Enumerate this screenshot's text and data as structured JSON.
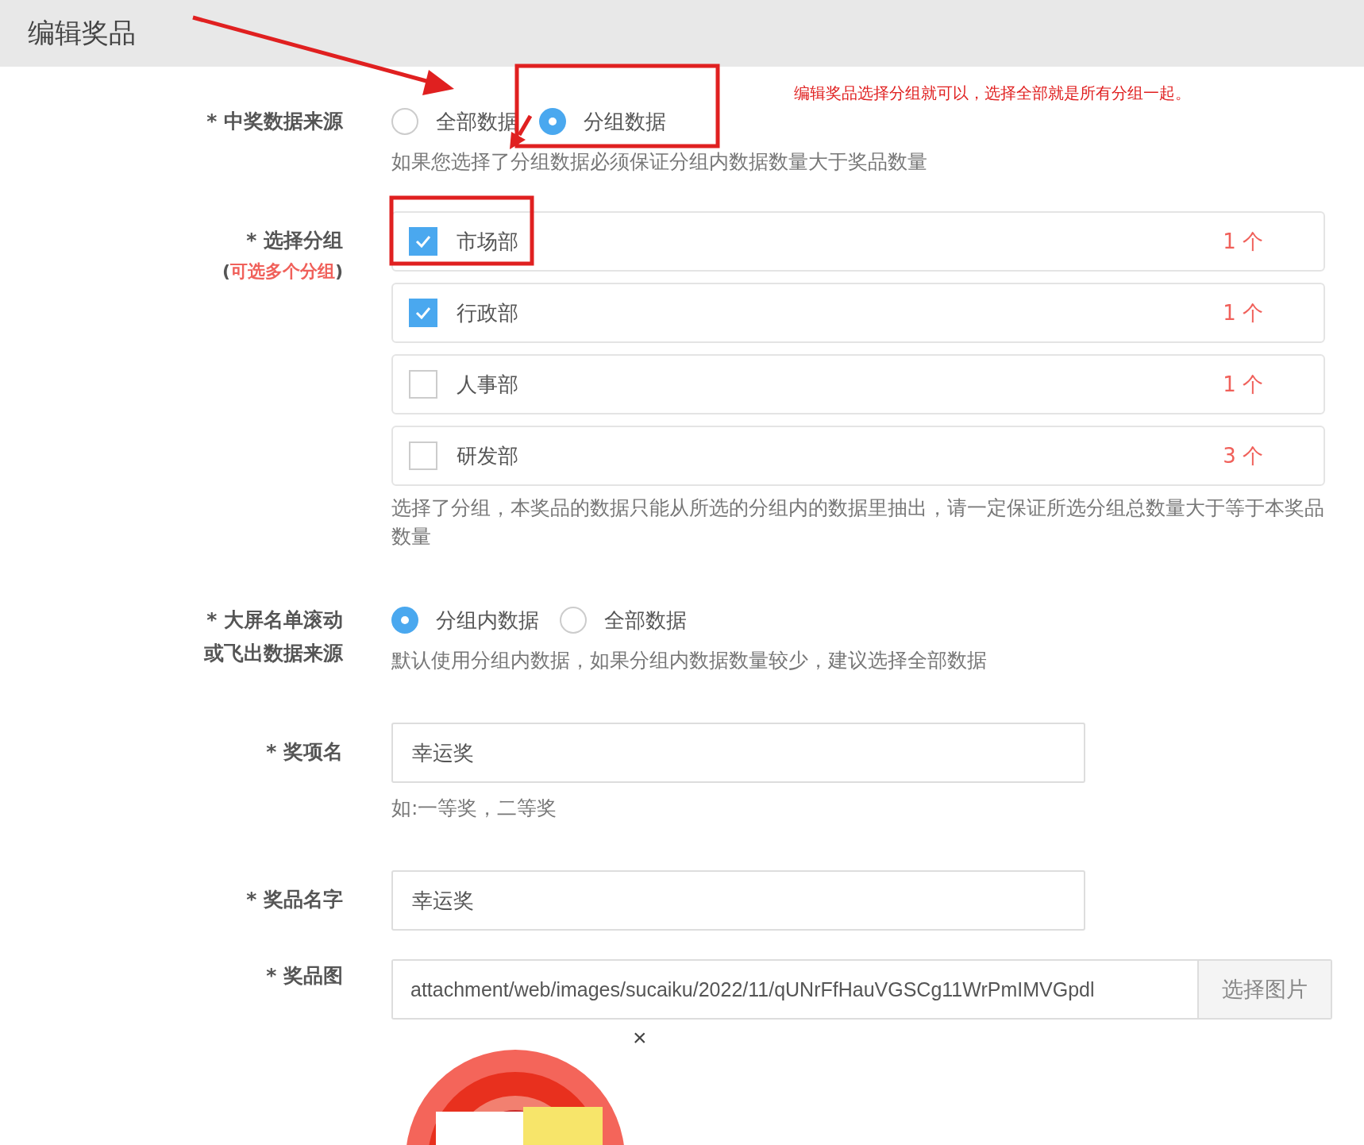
{
  "header": {
    "title": "编辑奖品"
  },
  "annotation": {
    "note": "编辑奖品选择分组就可以，选择全部就是所有分组一起。"
  },
  "fields": [
    {
      "kind": "radio",
      "marker": "*",
      "label_lines": [
        "中奖数据来源"
      ],
      "options": [
        {
          "label": "全部数据",
          "selected": false
        },
        {
          "label": "分组数据",
          "selected": true
        }
      ],
      "hint": "如果您选择了分组数据必须保证分组内数据数量大于奖品数量"
    },
    {
      "kind": "groups",
      "marker": "*",
      "label_lines": [
        "选择分组"
      ],
      "sublabel": {
        "open": "(",
        "text": "可选多个分组",
        "close": ")"
      },
      "groups": [
        {
          "name": "市场部",
          "count": "1 个",
          "checked": true
        },
        {
          "name": "行政部",
          "count": "1 个",
          "checked": true
        },
        {
          "name": "人事部",
          "count": "1 个",
          "checked": false
        },
        {
          "name": "研发部",
          "count": "3 个",
          "checked": false
        }
      ],
      "hint": "选择了分组，本奖品的数据只能从所选的分组内的数据里抽出，请一定保证所选分组总数量大于等于本奖品数量"
    },
    {
      "kind": "radio",
      "marker": "*",
      "label_lines": [
        "大屏名单滚动",
        "或飞出数据来源"
      ],
      "options": [
        {
          "label": "分组内数据",
          "selected": true
        },
        {
          "label": "全部数据",
          "selected": false
        }
      ],
      "hint": "默认使用分组内数据，如果分组内数据数量较少，建议选择全部数据"
    },
    {
      "kind": "text",
      "marker": "*",
      "label_lines": [
        "奖项名"
      ],
      "value": "幸运奖",
      "hint": "如:一等奖，二等奖"
    },
    {
      "kind": "text",
      "marker": "*",
      "label_lines": [
        "奖品名字"
      ],
      "value": "幸运奖"
    },
    {
      "kind": "image",
      "marker": "*",
      "label_lines": [
        "奖品图"
      ],
      "value": "attachment/web/images/sucaiku/2022/11/qUNrFfHauVGSCg11WrPmIMVGpdl",
      "button": "选择图片",
      "remove": "×"
    }
  ]
}
